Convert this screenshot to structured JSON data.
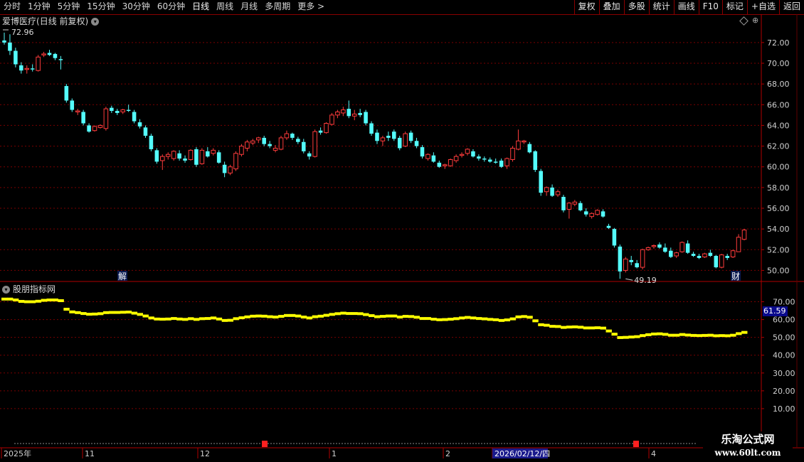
{
  "toolbar": {
    "periods": [
      "分时",
      "1分钟",
      "5分钟",
      "15分钟",
      "30分钟",
      "60分钟",
      "日线",
      "周线",
      "月线",
      "多周期",
      "更多 >"
    ],
    "active_period": "日线",
    "buttons": [
      "复权",
      "叠加",
      "多股",
      "统计",
      "画线",
      "F10",
      "标记",
      "+自选",
      "返回"
    ]
  },
  "stock": {
    "name": "爱博医疗",
    "mode": "(日线 前复权)"
  },
  "indicator": {
    "name": "股朋指标网",
    "current_value": "61.59"
  },
  "markers": {
    "high_label": "72.96",
    "low_label": "49.19",
    "event_1": "解",
    "event_2": "财"
  },
  "watermark": {
    "line1": "乐淘公式网",
    "line2": "www.60lt.com"
  },
  "colors": {
    "up": "#ff3c3c",
    "down": "#54fcfc",
    "indicator": "#ffff00",
    "grid": "#7a0000",
    "axis_label": "#d0d0d0",
    "active_date_bg": "#1a1a8c"
  },
  "chart_data": [
    {
      "type": "candlestick",
      "y_ticks": [
        "72.00",
        "70.00",
        "68.00",
        "66.00",
        "64.00",
        "62.00",
        "60.00",
        "58.00",
        "56.00",
        "54.00",
        "52.00",
        "50.00"
      ],
      "ylim": [
        49,
        73.5
      ],
      "x_labels": [
        "2025年",
        "11",
        "12",
        "1",
        "2",
        "2026/02/12/四",
        "4"
      ],
      "ohlc": [
        [
          72.2,
          72.96,
          71.8,
          72.0
        ],
        [
          72.0,
          72.8,
          70.8,
          71.2
        ],
        [
          71.2,
          71.5,
          69.6,
          69.9
        ],
        [
          69.8,
          70.1,
          69.0,
          69.3
        ],
        [
          69.4,
          69.8,
          69.0,
          69.5
        ],
        [
          69.5,
          69.9,
          69.2,
          69.4
        ],
        [
          69.3,
          70.8,
          69.2,
          70.6
        ],
        [
          70.8,
          71.1,
          70.6,
          70.9
        ],
        [
          71.0,
          71.3,
          70.7,
          70.8
        ],
        [
          70.9,
          71.0,
          70.3,
          70.5
        ],
        [
          70.4,
          70.7,
          69.4,
          70.3
        ],
        [
          67.8,
          68.0,
          66.2,
          66.4
        ],
        [
          66.4,
          66.6,
          65.3,
          65.5
        ],
        [
          65.3,
          65.6,
          65.0,
          65.4
        ],
        [
          65.3,
          65.5,
          64.0,
          64.2
        ],
        [
          64.0,
          64.2,
          63.3,
          63.4
        ],
        [
          63.5,
          64.0,
          63.4,
          63.9
        ],
        [
          63.8,
          64.1,
          63.7,
          64.0
        ],
        [
          63.7,
          65.8,
          63.5,
          65.6
        ],
        [
          65.7,
          65.9,
          65.2,
          65.4
        ],
        [
          65.4,
          65.6,
          65.0,
          65.2
        ],
        [
          65.3,
          65.6,
          65.1,
          65.5
        ],
        [
          65.5,
          66.0,
          65.3,
          65.4
        ],
        [
          65.3,
          65.5,
          64.2,
          64.4
        ],
        [
          64.3,
          64.6,
          63.7,
          63.9
        ],
        [
          63.8,
          64.0,
          62.8,
          63.0
        ],
        [
          63.0,
          63.2,
          61.5,
          61.7
        ],
        [
          61.6,
          61.8,
          60.3,
          60.5
        ],
        [
          60.6,
          61.2,
          59.7,
          61.0
        ],
        [
          61.0,
          61.4,
          60.7,
          61.2
        ],
        [
          60.8,
          61.6,
          60.6,
          61.5
        ],
        [
          61.3,
          61.6,
          60.6,
          60.8
        ],
        [
          60.8,
          61.1,
          60.4,
          60.6
        ],
        [
          60.7,
          61.7,
          60.6,
          61.6
        ],
        [
          61.7,
          61.9,
          60.0,
          60.2
        ],
        [
          60.3,
          61.8,
          60.2,
          61.6
        ],
        [
          61.5,
          61.9,
          60.9,
          61.0
        ],
        [
          61.3,
          61.8,
          61.1,
          61.6
        ],
        [
          61.4,
          61.6,
          60.3,
          60.4
        ],
        [
          60.2,
          60.5,
          59.0,
          59.4
        ],
        [
          59.4,
          60.2,
          59.2,
          60.0
        ],
        [
          59.8,
          61.5,
          59.6,
          61.3
        ],
        [
          61.2,
          62.2,
          61.0,
          62.0
        ],
        [
          61.8,
          62.6,
          61.5,
          62.4
        ],
        [
          62.3,
          62.7,
          62.1,
          62.5
        ],
        [
          62.6,
          62.9,
          62.3,
          62.8
        ],
        [
          62.8,
          63.0,
          62.0,
          62.2
        ],
        [
          62.2,
          62.5,
          61.8,
          62.0
        ],
        [
          61.6,
          62.1,
          61.4,
          61.8
        ],
        [
          61.7,
          63.0,
          61.6,
          62.8
        ],
        [
          62.8,
          63.5,
          62.6,
          63.2
        ],
        [
          63.2,
          63.3,
          62.6,
          62.8
        ],
        [
          62.7,
          62.9,
          62.2,
          62.4
        ],
        [
          62.4,
          62.7,
          61.3,
          61.5
        ],
        [
          61.3,
          61.5,
          60.7,
          61.0
        ],
        [
          61.0,
          63.6,
          60.9,
          63.4
        ],
        [
          63.5,
          63.8,
          63.1,
          63.3
        ],
        [
          63.3,
          64.3,
          63.2,
          64.2
        ],
        [
          64.1,
          65.2,
          64.0,
          65.0
        ],
        [
          65.0,
          65.5,
          64.7,
          65.3
        ],
        [
          65.2,
          65.8,
          64.9,
          65.5
        ],
        [
          65.6,
          66.4,
          64.7,
          64.9
        ],
        [
          64.9,
          65.5,
          64.5,
          65.1
        ],
        [
          65.2,
          65.6,
          64.8,
          65.0
        ],
        [
          65.3,
          65.5,
          64.0,
          64.2
        ],
        [
          64.2,
          64.4,
          63.0,
          63.2
        ],
        [
          63.3,
          63.6,
          62.2,
          62.5
        ],
        [
          62.5,
          63.0,
          62.0,
          62.8
        ],
        [
          63.0,
          63.4,
          62.5,
          62.8
        ],
        [
          63.4,
          63.6,
          62.5,
          62.7
        ],
        [
          62.8,
          63.0,
          61.6,
          61.8
        ],
        [
          62.0,
          63.4,
          61.9,
          63.2
        ],
        [
          63.3,
          63.5,
          62.3,
          62.5
        ],
        [
          62.5,
          62.8,
          61.8,
          62.0
        ],
        [
          61.9,
          62.1,
          60.8,
          61.0
        ],
        [
          60.8,
          61.3,
          60.6,
          61.2
        ],
        [
          61.1,
          61.4,
          60.4,
          60.5
        ],
        [
          60.4,
          60.6,
          59.9,
          60.0
        ],
        [
          60.1,
          60.3,
          59.8,
          60.2
        ],
        [
          60.1,
          60.8,
          60.0,
          60.7
        ],
        [
          60.6,
          61.2,
          60.4,
          61.0
        ],
        [
          61.1,
          61.4,
          60.9,
          61.2
        ],
        [
          61.3,
          61.8,
          61.1,
          61.7
        ],
        [
          61.5,
          61.7,
          60.9,
          61.0
        ],
        [
          61.0,
          61.2,
          60.6,
          60.8
        ],
        [
          60.8,
          61.0,
          60.5,
          60.7
        ],
        [
          60.7,
          60.9,
          60.4,
          60.5
        ],
        [
          60.5,
          60.8,
          60.3,
          60.4
        ],
        [
          60.6,
          60.8,
          59.9,
          60.0
        ],
        [
          60.1,
          60.9,
          59.8,
          60.8
        ],
        [
          60.7,
          62.0,
          60.5,
          61.8
        ],
        [
          61.7,
          63.6,
          61.6,
          62.5
        ],
        [
          62.4,
          62.6,
          62.2,
          62.5
        ],
        [
          62.2,
          62.4,
          61.3,
          61.4
        ],
        [
          61.5,
          61.6,
          59.5,
          59.7
        ],
        [
          59.6,
          59.8,
          57.2,
          57.5
        ],
        [
          57.6,
          58.1,
          57.2,
          58.0
        ],
        [
          58.0,
          58.3,
          57.1,
          57.2
        ],
        [
          57.3,
          57.8,
          57.1,
          57.6
        ],
        [
          57.1,
          57.3,
          55.6,
          55.8
        ],
        [
          55.9,
          56.6,
          55.0,
          56.5
        ],
        [
          56.4,
          56.8,
          56.2,
          56.6
        ],
        [
          56.5,
          56.7,
          55.7,
          55.8
        ],
        [
          55.7,
          56.0,
          55.2,
          55.4
        ],
        [
          55.2,
          55.6,
          55.0,
          55.5
        ],
        [
          55.4,
          55.9,
          55.3,
          55.8
        ],
        [
          55.7,
          55.9,
          55.1,
          55.2
        ],
        [
          54.3,
          54.5,
          54.0,
          54.1
        ],
        [
          54.0,
          54.1,
          52.2,
          52.4
        ],
        [
          52.3,
          52.5,
          49.19,
          49.9
        ],
        [
          50.0,
          51.3,
          49.8,
          51.1
        ],
        [
          51.0,
          51.4,
          50.5,
          50.8
        ],
        [
          50.7,
          51.0,
          50.2,
          50.3
        ],
        [
          50.3,
          52.1,
          50.1,
          52.0
        ],
        [
          52.0,
          52.3,
          51.9,
          52.2
        ],
        [
          52.3,
          52.5,
          52.1,
          52.4
        ],
        [
          52.5,
          52.7,
          52.1,
          52.2
        ],
        [
          52.2,
          52.6,
          51.7,
          51.8
        ],
        [
          51.9,
          52.2,
          51.2,
          51.3
        ],
        [
          51.4,
          51.8,
          51.2,
          51.7
        ],
        [
          51.8,
          52.8,
          51.7,
          52.7
        ],
        [
          52.6,
          52.9,
          51.6,
          51.7
        ],
        [
          51.6,
          51.8,
          51.3,
          51.4
        ],
        [
          51.4,
          51.6,
          51.1,
          51.2
        ],
        [
          51.3,
          51.7,
          51.2,
          51.6
        ],
        [
          51.7,
          52.0,
          51.3,
          51.4
        ],
        [
          51.4,
          51.5,
          50.2,
          50.3
        ],
        [
          50.3,
          51.6,
          50.2,
          51.5
        ],
        [
          51.4,
          51.6,
          51.0,
          51.2
        ],
        [
          51.3,
          52.0,
          51.2,
          51.9
        ],
        [
          51.8,
          53.5,
          51.8,
          53.2
        ],
        [
          53.0,
          54.0,
          52.9,
          53.9
        ]
      ]
    },
    {
      "type": "line",
      "name": "股朋指标网",
      "y_ticks": [
        "70.00",
        "60.00",
        "50.00",
        "40.00",
        "30.00",
        "20.00",
        "10.00"
      ],
      "ylim": [
        0,
        75
      ],
      "values": [
        71.5,
        71.5,
        71.0,
        70.2,
        70.0,
        70.0,
        70.3,
        70.8,
        71.0,
        71.0,
        70.6,
        65.8,
        64.3,
        63.9,
        63.4,
        63.0,
        63.1,
        63.3,
        63.9,
        64.0,
        64.0,
        64.1,
        64.2,
        63.6,
        62.9,
        62.0,
        60.9,
        60.3,
        60.2,
        60.3,
        60.6,
        60.3,
        60.1,
        60.5,
        60.1,
        60.5,
        60.6,
        60.9,
        60.3,
        59.5,
        59.6,
        60.5,
        61.0,
        61.5,
        61.9,
        62.0,
        61.9,
        61.6,
        61.4,
        61.8,
        62.3,
        62.3,
        62.0,
        61.4,
        60.9,
        61.6,
        61.9,
        62.4,
        62.9,
        63.3,
        63.6,
        63.4,
        63.4,
        63.3,
        62.8,
        62.2,
        61.6,
        61.8,
        62.0,
        62.0,
        61.4,
        61.8,
        61.7,
        61.3,
        60.6,
        60.6,
        60.2,
        59.9,
        60.0,
        60.2,
        60.5,
        60.9,
        61.2,
        60.9,
        60.6,
        60.4,
        60.1,
        59.9,
        59.5,
        59.8,
        60.4,
        61.5,
        61.7,
        61.3,
        59.3,
        57.1,
        56.8,
        56.2,
        56.1,
        55.6,
        55.8,
        55.9,
        55.7,
        55.3,
        55.3,
        55.4,
        55.2,
        53.6,
        51.8,
        49.9,
        50.0,
        50.2,
        50.4,
        51.0,
        51.5,
        51.9,
        52.0,
        51.7,
        51.2,
        51.2,
        51.6,
        51.3,
        51.1,
        51.0,
        51.1,
        51.2,
        50.9,
        51.0,
        50.9,
        51.2,
        52.1,
        52.8
      ]
    }
  ]
}
